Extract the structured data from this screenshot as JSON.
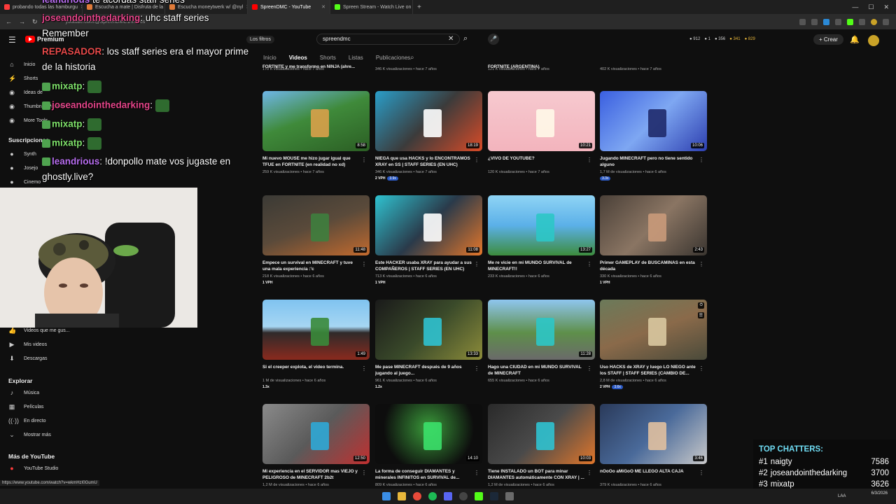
{
  "browser": {
    "tabs": [
      {
        "label": "probando todas las hamburgu",
        "color": "#ff3b3b",
        "active": false
      },
      {
        "label": "Escucha a mate | Disfruta de la",
        "color": "#e07b39",
        "active": false
      },
      {
        "label": "Escucha moneytwerk w/ @nyl",
        "color": "#e07b39",
        "active": false
      },
      {
        "label": "SpreenDMC - YouTube",
        "color": "#ff0000",
        "active": true
      },
      {
        "label": "Spreen Stream - Watch Live on",
        "color": "#53fc18",
        "active": false
      }
    ],
    "url": "youtube.com/@SpreenDMC1/videos",
    "status_url": "https://www.youtube.com/watch?v=wkmHzI0GumU"
  },
  "header": {
    "logo": "Premium",
    "filters_label": "Los filtros",
    "search_value": "spreendmc",
    "stats": [
      "912",
      "1",
      "356",
      "341",
      "829"
    ],
    "create_label": "Crear"
  },
  "sidebar": {
    "top": [
      "Inicio",
      "Shorts",
      "Ideas de",
      "Thumbnail Preview",
      "More Tools"
    ],
    "subs_title": "Suscripciones",
    "subs": [
      "Synth",
      "Josejo",
      "Cinemo"
    ],
    "you": [
      "Videos que me gus...",
      "Mis videos",
      "Descargas"
    ],
    "explore_title": "Explorar",
    "explore": [
      "Música",
      "Películas",
      "En directo",
      "Mostrar más"
    ],
    "more_title": "Más de YouTube",
    "more": [
      "YouTube Studio"
    ]
  },
  "channel_tabs": [
    "Inicio",
    "Videos",
    "Shorts",
    "Listas",
    "Publicaciones"
  ],
  "top_meta": [
    {
      "title": "FORTNITE y me transformo en NINJA (ahre...",
      "meta": "170 K visualizaciones • hace 7 años"
    },
    {
      "title": "",
      "meta": "346 K visualizaciones • hace 7 años"
    },
    {
      "title": "FORTNITE (ARGENTINA)",
      "meta": "121 K visualizaciones • hace 7 años"
    },
    {
      "title": "",
      "meta": "402 K visualizaciones • hace 7 años"
    }
  ],
  "videos": [
    {
      "title": "Mi nuevo MOUSE me hizo jugar igual que TFUE en FORTNITE (en realidad no xd)",
      "meta": "259 K visualizaciones • hace 7 años",
      "duration": "8:58",
      "vph": "",
      "badge": "",
      "bg": "linear-gradient(160deg,#6fb6e8 0%,#3f8a3a 45%,#2b5e24 100%)",
      "accent": "#d9a14a"
    },
    {
      "title": "NIEGA que usa HACKS y lo ENCONTRAMOS XRAY en SS | STAFF SERIES (EN UHC)",
      "meta": "346 K visualizaciones • hace 7 años",
      "duration": "18:19",
      "vph": "2 VPH",
      "badge": "3.9x",
      "bg": "linear-gradient(135deg,#2a9ec9 0%,#3b3b3b 50%,#d84b28 100%)",
      "accent": "#ffffff"
    },
    {
      "title": "¿VIVO DE YOUTUBE?",
      "meta": "120 K visualizaciones • hace 7 años",
      "duration": "10:21",
      "vph": "",
      "badge": "",
      "bg": "linear-gradient(180deg,#f6c9cf 0%,#f3b4bd 100%)",
      "accent": "#fff8e8"
    },
    {
      "title": "Jugando MINECRAFT pero no tiene sentido alguno",
      "meta": "1,7 M de visualizaciones • hace 6 años",
      "duration": "10:06",
      "vph": "",
      "badge": "3.3x",
      "bg": "linear-gradient(135deg,#3a5fe0 0%,#7ea7f2 50%,#2d3fb0 100%)",
      "accent": "#1f2a6b"
    },
    {
      "title": "Empece un survival en MINECRAFT y tuve una mala experiencia :'c",
      "meta": "218 K visualizaciones • hace 6 años",
      "duration": "11:48",
      "vph": "1 VPH",
      "badge": "",
      "bg": "linear-gradient(160deg,#3b3a35 0%,#5a4a3a 50%,#c26a2e 100%)",
      "accent": "#3e7e3e"
    },
    {
      "title": "Este HACKER usaba XRAY para ayudar a sus COMPAÑEROS | STAFF SERIES (EN UHC)",
      "meta": "713 K visualizaciones • hace 6 años",
      "duration": "11:08",
      "vph": "1 VPH",
      "badge": "",
      "bg": "linear-gradient(135deg,#2fc2d0 0%,#2a3a4a 50%,#e3762b 100%)",
      "accent": "#ffffff"
    },
    {
      "title": "Me re vicie en mi MUNDO SURVIVAL de MINECRAFT!!",
      "meta": "233 K visualizaciones • hace 6 años",
      "duration": "13:27",
      "vph": "",
      "badge": "",
      "bg": "linear-gradient(180deg,#8fd4f5 0%,#5bb0e8 50%,#3d8c3d 100%)",
      "accent": "#2cc6c6"
    },
    {
      "title": "Primer GAMEPLAY de BUSCAMINAS en esta década",
      "meta": "330 K visualizaciones • hace 6 años",
      "duration": "2:43",
      "vph": "1 VPH",
      "badge": "",
      "bg": "linear-gradient(135deg,#4a4038 0%,#8a7563 50%,#3a3530 100%)",
      "accent": "#c99a7a"
    },
    {
      "title": "Si el creeper explota, el video termina.",
      "meta": "1 M de visualizaciones • hace 6 años",
      "duration": "1:49",
      "vph": "1.3x",
      "badge": "",
      "bg": "linear-gradient(180deg,#7fc3f0 0%,#a6d6f3 45%,#2f2a2a 55%,#8a2a1e 100%)",
      "accent": "#3a8a3a"
    },
    {
      "title": "Me pase MINECRAFT después de 9 años jugando al juego...",
      "meta": "961 K visualizaciones • hace 6 años",
      "duration": "13:33",
      "vph": "1.2x",
      "badge": "",
      "bg": "linear-gradient(135deg,#1a1a1a 0%,#3a4a2a 50%,#8b8b3a 100%)",
      "accent": "#2fc2d0"
    },
    {
      "title": "Hago una CIUDAD en mi MUNDO SURVIVAL de MINECRAFT",
      "meta": "655 K visualizaciones • hace 6 años",
      "duration": "11:28",
      "vph": "",
      "badge": "",
      "bg": "linear-gradient(180deg,#8fc6ef 0%,#5e8f4a 55%,#6a6a6a 100%)",
      "accent": "#2cc6c6"
    },
    {
      "title": "Uso HACKS de XRAY y luego LO NIEGO ante los STAFF | STAFF SERIES (CAMBIO DE...",
      "meta": "2,8 M de visualizaciones • hace 6 años",
      "duration": "",
      "vph": "2 VPH",
      "badge": "3.6x",
      "bg": "linear-gradient(160deg,#6b7a5a 0%,#8a6a4a 50%,#4a4a3a 100%)",
      "accent": "#d9c8a0"
    },
    {
      "title": "Mi experiencia en el SERVIDOR mas VIEJO y PELIGROSO de MINECRAFT 2b2t",
      "meta": "1,2 M de visualizaciones • hace 6 años",
      "duration": "12:50",
      "vph": "",
      "badge": "",
      "bg": "linear-gradient(135deg,#8a8a8a 0%,#5a5a5a 50%,#c03030 100%)",
      "accent": "#2fa9d6"
    },
    {
      "title": "La forma de conseguir DIAMANTES y minerales INFINITOS en SURVIVAL de...",
      "meta": "809 K visualizaciones • hace 6 años",
      "duration": "14:10",
      "vph": "",
      "badge": "",
      "bg": "radial-gradient(circle at 50% 40%,#3a9a3a 0%,#0d0d0d 70%)",
      "accent": "#3be06a"
    },
    {
      "title": "Tiene INSTALADO un BOT para minar DIAMANTES automáticamente CON XRAY | ...",
      "meta": "1,2 M de visualizaciones • hace 6 años",
      "duration": "10:03",
      "vph": "",
      "badge": "",
      "bg": "linear-gradient(135deg,#2a2a2a 0%,#4a4a4a 50%,#e0762b 100%)",
      "accent": "#2fc2d0"
    },
    {
      "title": "nOoOo aMiGoO ME LLEGO ALTA CAJA",
      "meta": "379 K visualizaciones • hace 6 años",
      "duration": "3:46",
      "vph": "",
      "badge": "",
      "bg": "linear-gradient(135deg,#2a3a5a 0%,#4a6a9a 50%,#c9c9c9 100%)",
      "accent": "#e0c0a0"
    }
  ],
  "chat": [
    {
      "user": "leandrious",
      "msg": " te acordas staff series",
      "ucolor": "#b86ef0"
    },
    {
      "user": "joseandointhedarking",
      "msg": ": uhc staff series",
      "ucolor": "#e5458a"
    },
    {
      "user": "",
      "msg": "Remember",
      "ucolor": "#ffffff"
    },
    {
      "user": "REPASADOR",
      "msg": ": los staff series era el mayor prime",
      "ucolor": "#e84a4a"
    },
    {
      "user": "",
      "msg": "de la historia",
      "ucolor": "#ffffff"
    },
    {
      "user": "mixatp",
      "msg": ":",
      "ucolor": "#7ee06a"
    },
    {
      "user": "joseandointhedarking",
      "msg": ":",
      "ucolor": "#e5458a"
    },
    {
      "user": "mixatp",
      "msg": ":",
      "ucolor": "#7ee06a"
    },
    {
      "user": "mixatp",
      "msg": ":",
      "ucolor": "#7ee06a"
    },
    {
      "user": "leandrious",
      "msg": ": !donpollo mate vos jugaste en",
      "ucolor": "#b86ef0"
    },
    {
      "user": "",
      "msg": "ghostly.live?",
      "ucolor": "#ffffff"
    }
  ],
  "top_chatters": {
    "title": "TOP CHATTERS:",
    "list": [
      {
        "rank": "#1",
        "name": "naigty",
        "value": "7586"
      },
      {
        "rank": "#2",
        "name": "joseandointhedarking",
        "value": "3700"
      },
      {
        "rank": "#3",
        "name": "mixatp",
        "value": "3626"
      }
    ]
  },
  "taskbar": {
    "lang": "LAA",
    "date": "6/3/2026"
  }
}
